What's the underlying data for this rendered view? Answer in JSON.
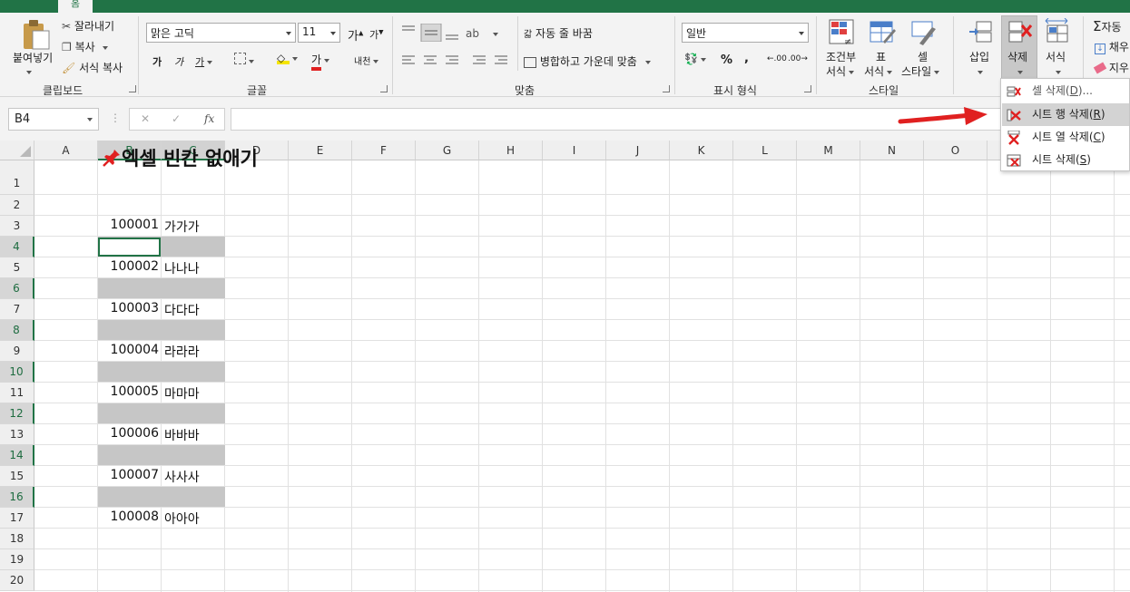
{
  "tabs": {
    "active": "홈"
  },
  "ribbon": {
    "clipboard": {
      "paste_label": "붙여넣기",
      "cut_label": "잘라내기",
      "copy_label": "복사",
      "format_painter_label": "서식 복사",
      "group_label": "클립보드"
    },
    "font": {
      "font_name": "맑은 고딕",
      "font_size": "11",
      "grow_label": "가",
      "shrink_label": "가",
      "bold_label": "가",
      "italic_label": "가",
      "underline_label": "가",
      "color_label": "가",
      "phonetic_label": "내천",
      "group_label": "글꼴"
    },
    "alignment": {
      "wrap_label": "자동 줄 바꿈",
      "merge_label": "병합하고 가운데 맞춤",
      "group_label": "맞춤"
    },
    "number": {
      "format_value": "일반",
      "percent": "%",
      "comma": ",",
      "inc_decimal": ".00",
      "dec_decimal": ".00",
      "group_label": "표시 형식"
    },
    "styles": {
      "cond_label_1": "조건부",
      "cond_label_2": "서식",
      "table_label_1": "표",
      "table_label_2": "서식",
      "cell_label_1": "셀",
      "cell_label_2": "스타일",
      "group_label": "스타일"
    },
    "cells": {
      "insert_label": "삽입",
      "delete_label": "삭제",
      "format_label": "서식"
    },
    "editing": {
      "autosum_label": "자동",
      "fill_label": "채우",
      "clear_label": "지우"
    }
  },
  "formula_bar": {
    "name_box": "B4",
    "cancel": "✕",
    "enter": "✓",
    "fx": "fx",
    "value": ""
  },
  "columns": [
    "A",
    "B",
    "C",
    "D",
    "E",
    "F",
    "G",
    "H",
    "I",
    "J",
    "K",
    "L",
    "M",
    "N",
    "O"
  ],
  "rows": [
    "1",
    "2",
    "3",
    "4",
    "5",
    "6",
    "7",
    "8",
    "9",
    "10",
    "11",
    "12",
    "13",
    "14",
    "15",
    "16",
    "17",
    "18",
    "19",
    "20"
  ],
  "sheet": {
    "title": "엑셀 빈칸 없애기",
    "entries": [
      {
        "num": "100001",
        "name": "가가가"
      },
      {
        "num": "100002",
        "name": "나나나"
      },
      {
        "num": "100003",
        "name": "다다다"
      },
      {
        "num": "100004",
        "name": "라라라"
      },
      {
        "num": "100005",
        "name": "마마마"
      },
      {
        "num": "100006",
        "name": "바바바"
      },
      {
        "num": "100007",
        "name": "사사사"
      },
      {
        "num": "100008",
        "name": "아아아"
      }
    ]
  },
  "delete_menu": {
    "items": [
      {
        "label": "셀 삭제(",
        "key": "D",
        "suffix": ")..."
      },
      {
        "label": "시트 행 삭제(",
        "key": "R",
        "suffix": ")"
      },
      {
        "label": "시트 열 삭제(",
        "key": "C",
        "suffix": ")"
      },
      {
        "label": "시트 삭제(",
        "key": "S",
        "suffix": ")"
      }
    ]
  },
  "colors": {
    "excel_green": "#217346",
    "annotation_red": "#e02020",
    "fill_gray": "#c6c6c6"
  }
}
